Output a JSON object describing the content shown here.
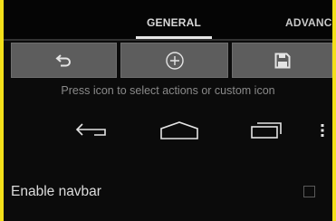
{
  "tabs": {
    "general": "GENERAL",
    "advanced": "ADVANCED"
  },
  "actions": [
    {
      "icon": "undo-icon"
    },
    {
      "icon": "add-circle-icon"
    },
    {
      "icon": "save-icon"
    }
  ],
  "hint": "Press icon to select actions or custom icon",
  "navbar_preview": [
    "back-icon",
    "home-icon",
    "recent-apps-icon",
    "menu-icon"
  ],
  "settings": {
    "enable_navbar_label": "Enable navbar",
    "enable_navbar_checked": false
  },
  "colors": {
    "frame": "#f3e01a",
    "background": "#0b0b0b",
    "button": "#5d5d5d",
    "icon": "#dcdcdc"
  }
}
